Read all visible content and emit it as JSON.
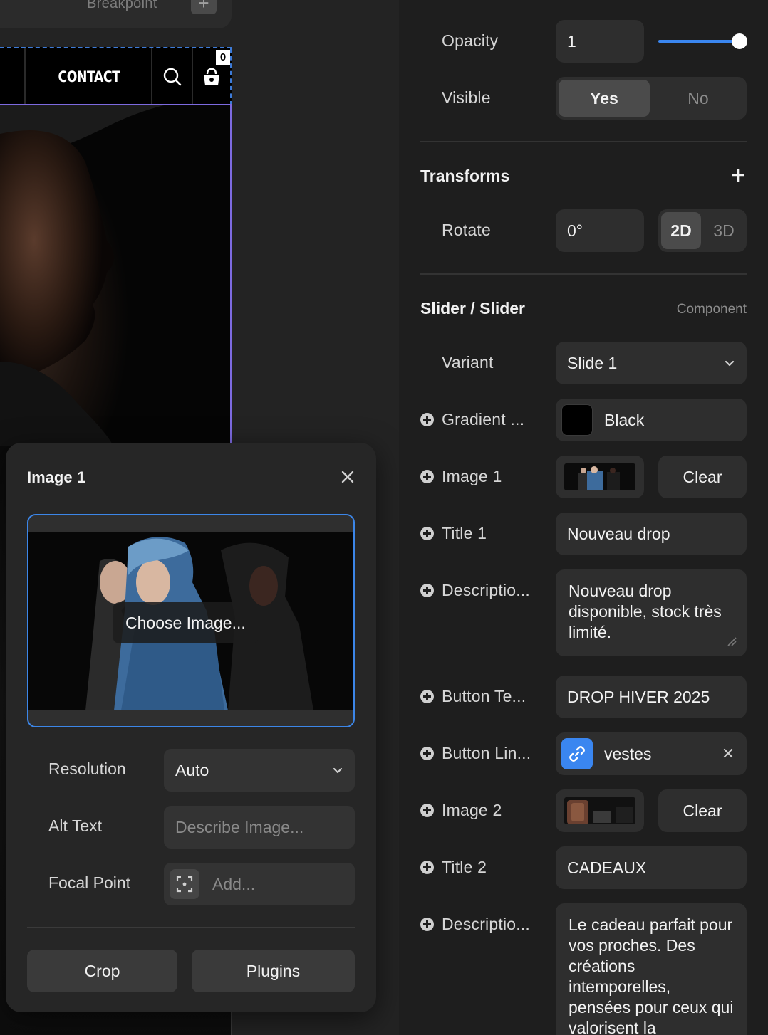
{
  "canvas": {
    "breakpoint_label": "Breakpoint",
    "nav_contact": "CONTACT",
    "cart_count": "0"
  },
  "popover": {
    "title": "Image 1",
    "choose_label": "Choose Image...",
    "resolution_label": "Resolution",
    "resolution_value": "Auto",
    "alt_label": "Alt Text",
    "alt_placeholder": "Describe Image...",
    "focal_label": "Focal Point",
    "focal_placeholder": "Add...",
    "crop_label": "Crop",
    "plugins_label": "Plugins"
  },
  "panel": {
    "opacity": {
      "label": "Opacity",
      "value": "1",
      "slider_fraction": 1.0
    },
    "visible": {
      "label": "Visible",
      "yes": "Yes",
      "no": "No",
      "selected": "Yes"
    },
    "transforms": {
      "title": "Transforms",
      "rotate_label": "Rotate",
      "rotate_value": "0°",
      "mode_2d": "2D",
      "mode_3d": "3D",
      "selected": "2D"
    },
    "component": {
      "title": "Slider / Slider",
      "tag": "Component",
      "variant_label": "Variant",
      "variant_value": "Slide 1",
      "gradient_label": "Gradient ...",
      "gradient_value": "Black",
      "image1_label": "Image 1",
      "clear_label": "Clear",
      "title1_label": "Title 1",
      "title1_value": "Nouveau drop",
      "desc1_label": "Descriptio...",
      "desc1_value": "Nouveau drop disponible, stock très limité.",
      "button_text_label": "Button Te...",
      "button_text_value": "DROP HIVER 2025",
      "button_link_label": "Button Lin...",
      "button_link_value": "vestes",
      "image2_label": "Image 2",
      "title2_label": "Title 2",
      "title2_value": "CADEAUX",
      "desc2_label": "Descriptio...",
      "desc2_value": "Le cadeau parfait pour vos proches. Des créations intemporelles, pensées pour ceux qui valorisent la"
    }
  },
  "colors": {
    "accent": "#3a86f0",
    "selection": "#7d6ae0",
    "panel_bg": "#1e1e1e",
    "field_bg": "#2e2e2e"
  }
}
